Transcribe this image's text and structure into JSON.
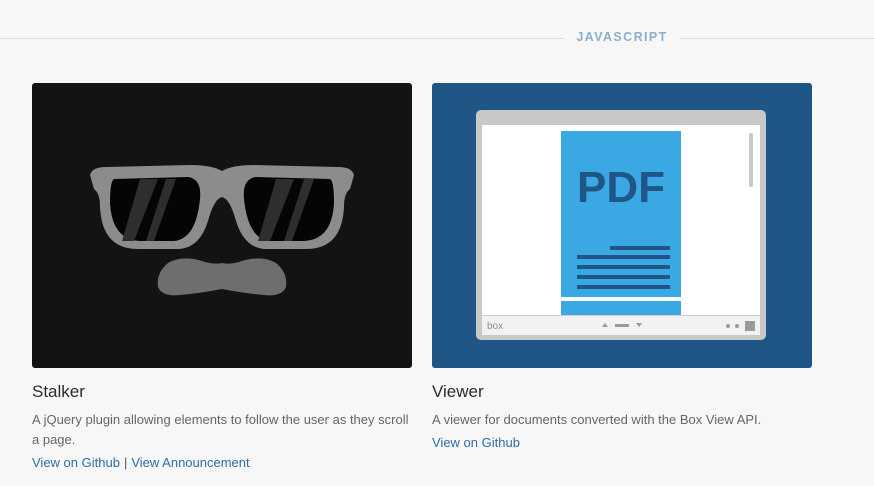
{
  "section": {
    "title": "JAVASCRIPT"
  },
  "projects": [
    {
      "title": "Stalker",
      "description": "A jQuery plugin allowing elements to follow the user as they scroll a page.",
      "links": [
        "View on Github",
        "View Announcement"
      ],
      "separator": "|",
      "image_icon": "glasses-mustache-icon"
    },
    {
      "title": "Viewer",
      "description": "A viewer for documents converted with the Box View API.",
      "links": [
        "View on Github"
      ],
      "image_icon": "pdf-viewer-icon",
      "image_text": {
        "doc": "PDF",
        "brand": "box"
      }
    }
  ],
  "colors": {
    "card1_bg": "#131313",
    "card2_bg": "#1f5686",
    "link": "#2d6da3",
    "pdf_blue": "#39a8e3"
  }
}
